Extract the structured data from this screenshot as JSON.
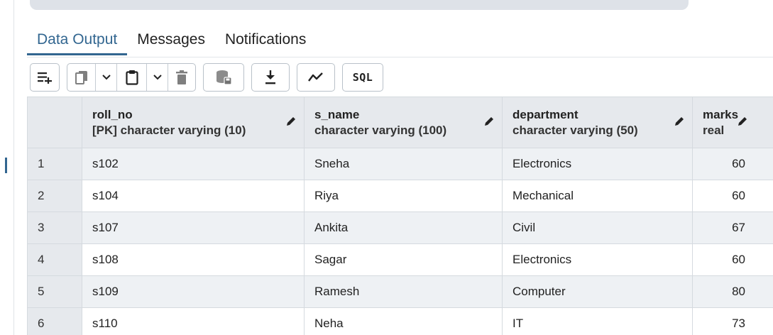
{
  "tabs": [
    {
      "label": "Data Output",
      "active": true
    },
    {
      "label": "Messages",
      "active": false
    },
    {
      "label": "Notifications",
      "active": false
    }
  ],
  "toolbar": {
    "buttons": [
      {
        "icon": "add-row-icon"
      },
      {
        "icon": "copy-icon"
      },
      {
        "icon": "chevron-down-icon"
      },
      {
        "icon": "paste-icon"
      },
      {
        "icon": "chevron-down-icon"
      },
      {
        "icon": "delete-icon"
      },
      {
        "icon": "save-data-icon"
      },
      {
        "icon": "download-icon"
      },
      {
        "icon": "graph-icon"
      }
    ],
    "sql_label": "SQL"
  },
  "colors": {
    "accent": "#326690",
    "header_bg": "#e6e9ed",
    "stripe_bg": "#eef1f4"
  },
  "grid": {
    "columns": [
      {
        "name": "roll_no",
        "type": "[PK] character varying (10)"
      },
      {
        "name": "s_name",
        "type": "character varying (100)"
      },
      {
        "name": "department",
        "type": "character varying (50)"
      },
      {
        "name": "marks",
        "type": "real"
      }
    ],
    "rows": [
      {
        "num": "1",
        "roll_no": "s102",
        "s_name": "Sneha",
        "department": "Electronics",
        "marks": "60"
      },
      {
        "num": "2",
        "roll_no": "s104",
        "s_name": "Riya",
        "department": "Mechanical",
        "marks": "60"
      },
      {
        "num": "3",
        "roll_no": "s107",
        "s_name": "Ankita",
        "department": "Civil",
        "marks": "67"
      },
      {
        "num": "4",
        "roll_no": "s108",
        "s_name": "Sagar",
        "department": "Electronics",
        "marks": "60"
      },
      {
        "num": "5",
        "roll_no": "s109",
        "s_name": "Ramesh",
        "department": "Computer",
        "marks": "80"
      },
      {
        "num": "6",
        "roll_no": "s110",
        "s_name": "Neha",
        "department": "IT",
        "marks": "73"
      }
    ]
  }
}
